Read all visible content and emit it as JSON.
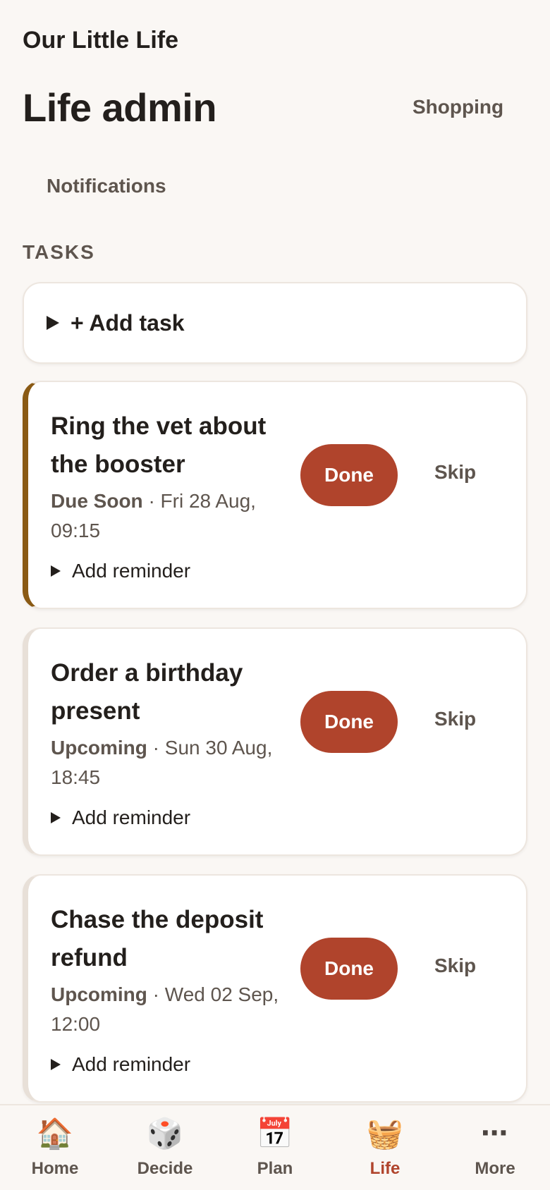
{
  "app": {
    "name": "Our Little Life"
  },
  "header": {
    "title": "Life admin",
    "shopping_label": "Shopping",
    "notifications_label": "Notifications"
  },
  "tasks_section": {
    "label": "TASKS",
    "add_task_label": "+ Add task",
    "items": [
      {
        "title": "Ring the vet about the booster",
        "status": "Due Soon",
        "due": "· Fri 28 Aug, 09:15",
        "done_label": "Done",
        "skip_label": "Skip",
        "reminder_label": "Add reminder",
        "accent": "#8a5a14"
      },
      {
        "title": "Order a birthday present",
        "status": "Upcoming",
        "due": "· Sun 30 Aug, 18:45",
        "done_label": "Done",
        "skip_label": "Skip",
        "reminder_label": "Add reminder",
        "accent": "#e8e0d8"
      },
      {
        "title": "Chase the deposit refund",
        "status": "Upcoming",
        "due": "· Wed 02 Sep, 12:00",
        "done_label": "Done",
        "skip_label": "Skip",
        "reminder_label": "Add reminder",
        "accent": "#e8e0d8"
      }
    ]
  },
  "nav": {
    "items": [
      {
        "label": "Home",
        "icon": "house-icon",
        "glyph": "🏠",
        "active": false
      },
      {
        "label": "Decide",
        "icon": "dice-icon",
        "glyph": "🎲",
        "active": false
      },
      {
        "label": "Plan",
        "icon": "calendar-icon",
        "glyph": "📅",
        "active": false
      },
      {
        "label": "Life",
        "icon": "basket-icon",
        "glyph": "🧺",
        "active": true
      },
      {
        "label": "More",
        "icon": "more-icon",
        "glyph": "⋯",
        "active": false
      }
    ]
  },
  "colors": {
    "accent": "#b0442c",
    "background": "#faf7f4",
    "due_soon": "#8a5a14"
  }
}
